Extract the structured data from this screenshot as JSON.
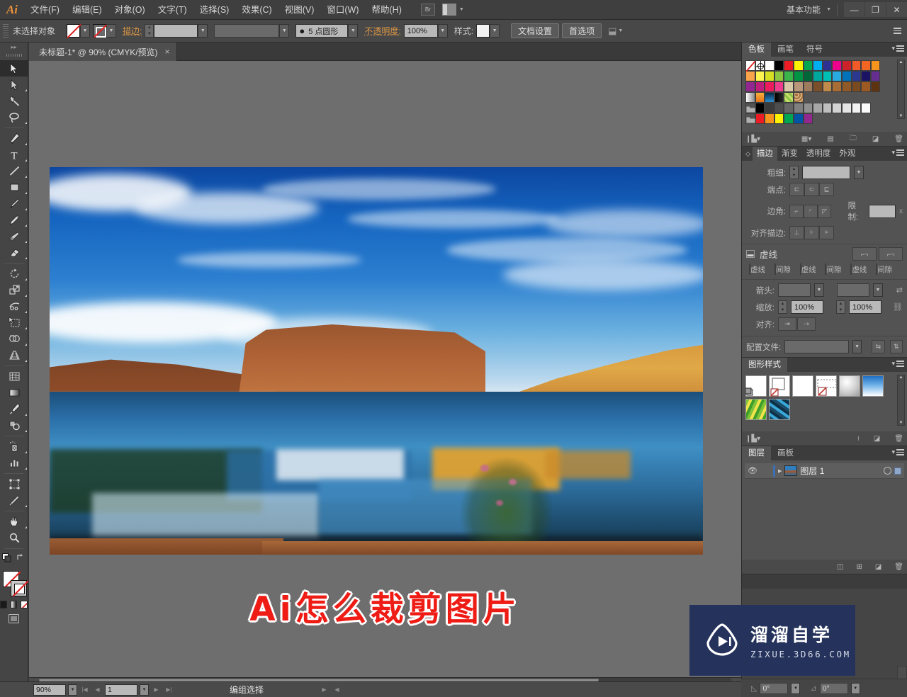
{
  "app": {
    "logo": "Ai",
    "workspace": "基本功能",
    "window_buttons": {
      "minimize": "—",
      "restore": "❐",
      "close": "✕"
    },
    "bridge_label": "Br"
  },
  "menubar": {
    "items": [
      {
        "label": "文件(F)"
      },
      {
        "label": "编辑(E)"
      },
      {
        "label": "对象(O)"
      },
      {
        "label": "文字(T)"
      },
      {
        "label": "选择(S)"
      },
      {
        "label": "效果(C)"
      },
      {
        "label": "视图(V)"
      },
      {
        "label": "窗口(W)"
      },
      {
        "label": "帮助(H)"
      }
    ]
  },
  "controlbar": {
    "selection_status": "未选择对象",
    "stroke_label": "描边:",
    "stroke_weight": "",
    "brush_definition": "5 点圆形",
    "opacity_label": "不透明度:",
    "opacity_value": "100%",
    "style_label": "样式:",
    "doc_setup_button": "文档设置",
    "preferences_button": "首选项"
  },
  "toolbar": {
    "tools": [
      {
        "name": "selection-tool",
        "label": "选择工具"
      },
      {
        "name": "direct-selection-tool",
        "label": "直接选择工具"
      },
      {
        "name": "magic-wand-tool",
        "label": "魔棒工具"
      },
      {
        "name": "lasso-tool",
        "label": "套索工具"
      },
      {
        "name": "pen-tool",
        "label": "钢笔工具"
      },
      {
        "name": "type-tool",
        "label": "文字工具"
      },
      {
        "name": "line-segment-tool",
        "label": "直线段工具"
      },
      {
        "name": "rectangle-tool",
        "label": "矩形工具"
      },
      {
        "name": "paintbrush-tool",
        "label": "画笔工具"
      },
      {
        "name": "pencil-tool",
        "label": "铅笔工具"
      },
      {
        "name": "blob-brush-tool",
        "label": "斑点画笔工具"
      },
      {
        "name": "eraser-tool",
        "label": "橡皮擦工具"
      },
      {
        "name": "rotate-tool",
        "label": "旋转工具"
      },
      {
        "name": "scale-tool",
        "label": "比例缩放工具"
      },
      {
        "name": "width-tool",
        "label": "宽度工具"
      },
      {
        "name": "free-transform-tool",
        "label": "自由变换工具"
      },
      {
        "name": "shape-builder-tool",
        "label": "形状生成器工具"
      },
      {
        "name": "perspective-grid-tool",
        "label": "透视网格工具"
      },
      {
        "name": "mesh-tool",
        "label": "网格工具"
      },
      {
        "name": "gradient-tool",
        "label": "渐变工具"
      },
      {
        "name": "eyedropper-tool",
        "label": "吸管工具"
      },
      {
        "name": "blend-tool",
        "label": "混合工具"
      },
      {
        "name": "symbol-sprayer-tool",
        "label": "符号喷枪工具"
      },
      {
        "name": "column-graph-tool",
        "label": "柱形图工具"
      },
      {
        "name": "artboard-tool",
        "label": "画板工具"
      },
      {
        "name": "slice-tool",
        "label": "切片工具"
      },
      {
        "name": "hand-tool",
        "label": "抓手工具"
      },
      {
        "name": "zoom-tool",
        "label": "缩放工具"
      }
    ]
  },
  "document": {
    "tab_title": "未标题-1* @ 90% (CMYK/预览)",
    "close_label": "×",
    "canvas_title_text": "Ai怎么裁剪图片"
  },
  "statusbar": {
    "zoom": "90%",
    "page": "1",
    "status_text": "编组选择",
    "rotate_value": "0°",
    "shear_value": "0°"
  },
  "panels": {
    "swatches": {
      "tabs": [
        {
          "label": "色板",
          "active": true
        },
        {
          "label": "画笔",
          "active": false
        },
        {
          "label": "符号",
          "active": false
        }
      ],
      "rows": [
        [
          "none",
          "registration",
          "#ffffff",
          "#000000",
          "#ed1c24",
          "#fff200",
          "#00a651",
          "#00aeef",
          "#2e3192",
          "#ec008c",
          "#cc2229",
          "#f15a29",
          "#f26522",
          "#f7941e"
        ],
        [
          "#f9a34a",
          "#fff44f",
          "#d7df23",
          "#8dc63f",
          "#39b54a",
          "#009444",
          "#006838",
          "#00a79d",
          "#00c0b5",
          "#29abe2",
          "#0072bc",
          "#2b3990",
          "#1b1464",
          "#662d91"
        ],
        [
          "#92278f",
          "#bf1e7c",
          "#ec1c5f",
          "#ed3e8e",
          "#d9c9a8",
          "#b8977a",
          "#9e7b5c",
          "#7a4f2a",
          "#c08a4a",
          "#a86d35",
          "#8f5a28",
          "#7a4a20",
          "#9c5a22",
          "#5e3312"
        ],
        [
          "grad-white",
          "grad-orange",
          "grad-blue",
          "grad-black",
          "pattern-leaf",
          "pattern-dots"
        ],
        [
          "folder",
          "#000000",
          "#3a3a3a",
          "#4d4d4d",
          "#666666",
          "#808080",
          "#909090",
          "#a6a6a6",
          "#bfbfbf",
          "#d2d2d2",
          "#e6e6e6",
          "#f2f2f2",
          "#fafafa"
        ],
        [
          "folder",
          "#ed1c24",
          "#f7941e",
          "#fff200",
          "#00a651",
          "#0054a6",
          "#92278f"
        ]
      ]
    },
    "stroke": {
      "tabs": [
        {
          "label": "描边",
          "active": true
        },
        {
          "label": "渐变",
          "active": false
        },
        {
          "label": "透明度",
          "active": false
        },
        {
          "label": "外观",
          "active": false
        }
      ],
      "weight_label": "粗细:",
      "weight_value": "",
      "cap_label": "端点:",
      "corner_label": "边角:",
      "limit_label": "限制:",
      "limit_value": "",
      "limit_unit": "x",
      "align_label": "对齐描边:",
      "dashed_label": "虚线",
      "dash_fields": [
        {
          "label": "虚线"
        },
        {
          "label": "间隙"
        },
        {
          "label": "虚线"
        },
        {
          "label": "间隙"
        },
        {
          "label": "虚线"
        },
        {
          "label": "间隙"
        }
      ],
      "arrow_label": "箭头:",
      "scale_label": "缩放:",
      "scale_start": "100%",
      "scale_end": "100%",
      "align_arrow_label": "对齐:",
      "profile_label": "配置文件:",
      "profile_value": ""
    },
    "graphic_styles": {
      "tabs": [
        {
          "label": "图形样式",
          "active": true
        }
      ],
      "count": 8
    },
    "layers": {
      "tabs": [
        {
          "label": "图层",
          "active": true
        },
        {
          "label": "画板",
          "active": false
        }
      ],
      "rows": [
        {
          "name": "图层 1",
          "index": "1",
          "visible": true,
          "selected": true
        }
      ]
    }
  },
  "watermark": {
    "cn": "溜溜自学",
    "en": "ZIXUE.3D66.COM"
  },
  "colors": {
    "accent_orange": "#d99545",
    "title_red": "#ee1c14",
    "watermark_bg": "#25335c",
    "panel_bg": "#535353",
    "chrome_bg": "#454545"
  }
}
